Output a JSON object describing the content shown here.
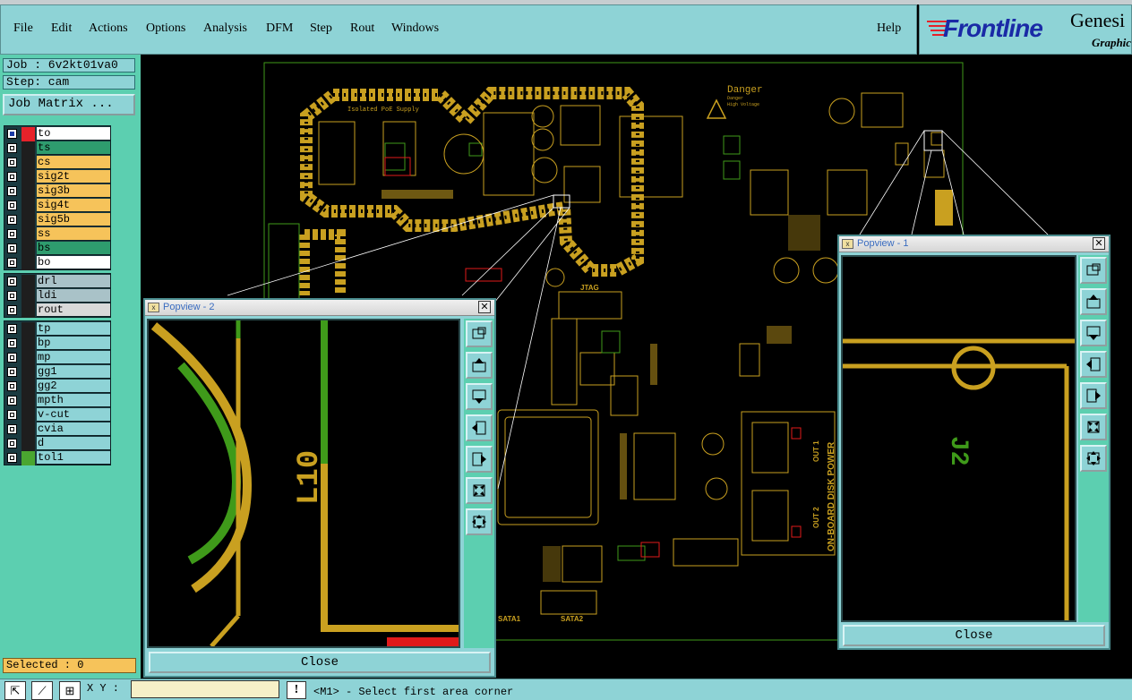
{
  "menubar": {
    "items": [
      "File",
      "Edit",
      "Actions",
      "Options",
      "Analysis",
      "DFM",
      "Step",
      "Rout",
      "Windows"
    ],
    "help": "Help"
  },
  "logo": {
    "brand": "Frontline",
    "product": "Genesi",
    "sub": "Graphic"
  },
  "job": {
    "job": "Job : 6v2kt01va0",
    "step": "Step: cam",
    "matrix_button": "Job Matrix ..."
  },
  "layers": {
    "board": [
      {
        "name": "to",
        "color": "#e6222a",
        "fill": "#ffffff",
        "active": true
      },
      {
        "name": "ts",
        "color": "#1e1e1e",
        "fill": "#2e9c6e"
      },
      {
        "name": "cs",
        "color": "#1e1e1e",
        "fill": "#f6c35a"
      },
      {
        "name": "sig2t",
        "color": "#1e1e1e",
        "fill": "#f6c35a"
      },
      {
        "name": "sig3b",
        "color": "#1e1e1e",
        "fill": "#f6c35a"
      },
      {
        "name": "sig4t",
        "color": "#1e1e1e",
        "fill": "#f6c35a"
      },
      {
        "name": "sig5b",
        "color": "#1e1e1e",
        "fill": "#f6c35a"
      },
      {
        "name": "ss",
        "color": "#1e1e1e",
        "fill": "#f6c35a"
      },
      {
        "name": "bs",
        "color": "#1e1e1e",
        "fill": "#2e9c6e"
      },
      {
        "name": "bo",
        "color": "#1e1e1e",
        "fill": "#ffffff"
      }
    ],
    "drill": [
      {
        "name": "drl",
        "color": "#1e1e1e",
        "fill": "#a9c2c8"
      },
      {
        "name": "ldi",
        "color": "#1e1e1e",
        "fill": "#a9c2c8"
      },
      {
        "name": "rout",
        "color": "#1e1e1e",
        "fill": "#d9d9d9"
      }
    ],
    "misc": [
      {
        "name": "tp",
        "color": "#1e1e1e",
        "fill": "#8ed3d6"
      },
      {
        "name": "bp",
        "color": "#1e1e1e",
        "fill": "#8ed3d6"
      },
      {
        "name": "mp",
        "color": "#1e1e1e",
        "fill": "#8ed3d6"
      },
      {
        "name": "gg1",
        "color": "#1e1e1e",
        "fill": "#8ed3d6"
      },
      {
        "name": "gg2",
        "color": "#1e1e1e",
        "fill": "#8ed3d6"
      },
      {
        "name": "mpth",
        "color": "#1e1e1e",
        "fill": "#8ed3d6"
      },
      {
        "name": "v-cut",
        "color": "#1e1e1e",
        "fill": "#8ed3d6"
      },
      {
        "name": "cvia",
        "color": "#1e1e1e",
        "fill": "#8ed3d6"
      },
      {
        "name": "d",
        "color": "#1e1e1e",
        "fill": "#8ed3d6"
      },
      {
        "name": "tol1",
        "color": "#4aa630",
        "fill": "#8ed3d6"
      }
    ]
  },
  "selected": "Selected : 0",
  "status": {
    "xy_label": "X Y :",
    "xy_value": "",
    "message_button": "!",
    "message": "<M1> - Select first area corner"
  },
  "board_labels": {
    "danger": "Danger",
    "danger_sub1": "Danger",
    "danger_sub2": "High Voltage",
    "isolated": "Isolated PoE Supply",
    "jtag": "JTAG",
    "sata1": "SATA1",
    "sata2": "SATA2",
    "power": "ON-BOARD DISK POWER",
    "out1": "OUT 1",
    "out2": "OUT 2"
  },
  "popview2": {
    "title": "Popview - 2",
    "label": "L10",
    "close": "Close"
  },
  "popview1": {
    "title": "Popview - 1",
    "label": "J2",
    "close": "Close"
  },
  "colors": {
    "copper": "#c9a020",
    "green": "#3f9a1a",
    "red": "#e01a1a",
    "panel": "#8ed3d6",
    "teal": "#5ccfb0"
  }
}
